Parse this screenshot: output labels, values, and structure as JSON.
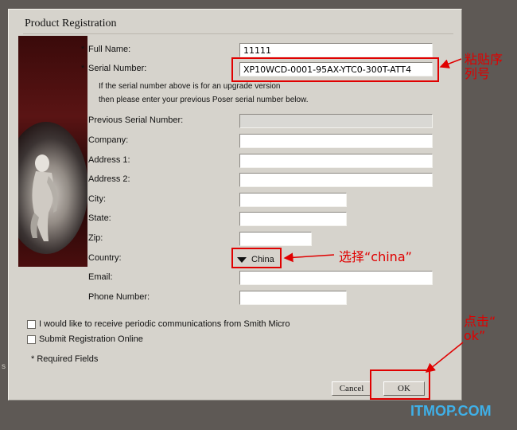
{
  "dialog": {
    "title": "Product Registration",
    "serial_hint_line1": "If the serial number above is for an upgrade version",
    "serial_hint_line2": "then please enter your previous Poser serial number below.",
    "required_note": "* Required Fields"
  },
  "fields": {
    "full_name": {
      "label": "Full Name:",
      "required_mark": "*",
      "value": "11111"
    },
    "serial_number": {
      "label": "Serial Number:",
      "required_mark": "*",
      "value": "XP10WCD-0001-95AX-YTC0-300T-ATT4"
    },
    "previous_serial": {
      "label": "Previous Serial Number:",
      "value": ""
    },
    "company": {
      "label": "Company:",
      "value": ""
    },
    "address1": {
      "label": "Address 1:",
      "value": ""
    },
    "address2": {
      "label": "Address 2:",
      "value": ""
    },
    "city": {
      "label": "City:",
      "value": ""
    },
    "state": {
      "label": "State:",
      "value": ""
    },
    "zip": {
      "label": "Zip:",
      "value": ""
    },
    "country": {
      "label": "Country:",
      "value": "China"
    },
    "email": {
      "label": "Email:",
      "value": ""
    },
    "phone": {
      "label": "Phone Number:",
      "value": ""
    }
  },
  "options": {
    "periodic_comms": {
      "label": "I would like to receive periodic communications from Smith Micro",
      "checked": false
    },
    "register_online": {
      "label": "Submit Registration Online",
      "checked": false
    }
  },
  "buttons": {
    "cancel": "Cancel",
    "ok": "OK"
  },
  "annotations": {
    "paste_serial": "粘贴序列号",
    "paste_serial_line1": "粘贴序",
    "paste_serial_line2": "列号",
    "choose_china": "选择“china”",
    "click_ok_line1": "点击“",
    "click_ok_line2": "ok”",
    "highlight_color": "#e00000"
  },
  "watermark": "ITMOP.COM",
  "edge_text": "s"
}
